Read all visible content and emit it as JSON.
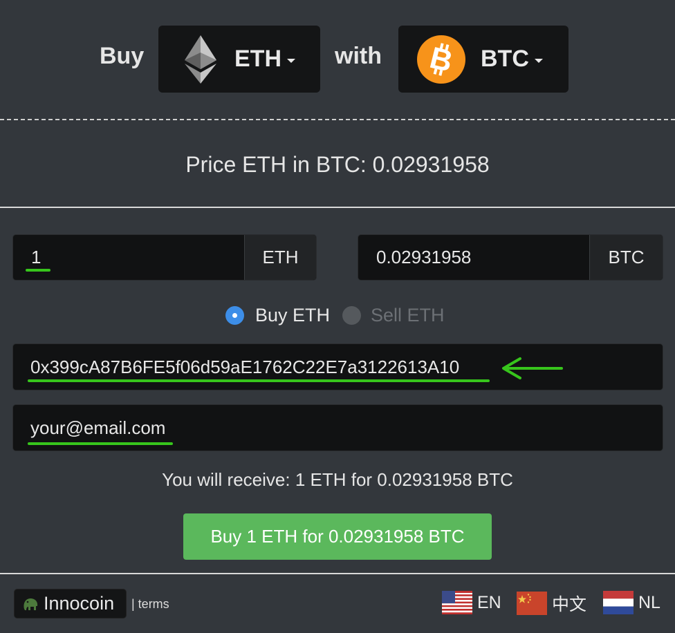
{
  "header": {
    "buy_word": "Buy",
    "with_word": "with",
    "buy_currency": {
      "label": "ETH",
      "icon": "ethereum-icon"
    },
    "pay_currency": {
      "label": "BTC",
      "icon": "bitcoin-icon",
      "color": "#f7931a"
    }
  },
  "price_line": "Price ETH in BTC: 0.02931958",
  "amount": {
    "eth_value": "1",
    "eth_unit": "ETH",
    "btc_value": "0.02931958",
    "btc_unit": "BTC"
  },
  "mode": {
    "buy_label": "Buy ETH",
    "sell_label": "Sell ETH",
    "selected": "buy"
  },
  "address_value": "0x399cA87B6FE5f06d59aE1762C22E7a3122613A10",
  "email_value": "your@email.com",
  "receive_text": "You will receive: 1 ETH for 0.02931958 BTC",
  "buy_button_label": "Buy 1 ETH for 0.02931958 BTC",
  "footer": {
    "brand": "Innocoin",
    "terms": "| terms",
    "languages": [
      {
        "code": "EN",
        "icon": "us-flag-icon"
      },
      {
        "code": "中文",
        "icon": "china-flag-icon"
      },
      {
        "code": "NL",
        "icon": "netherlands-flag-icon"
      }
    ]
  },
  "colors": {
    "background": "#33373c",
    "highlight": "#37c51c",
    "button": "#5bb85c",
    "radio_selected": "#3d8ee8"
  }
}
